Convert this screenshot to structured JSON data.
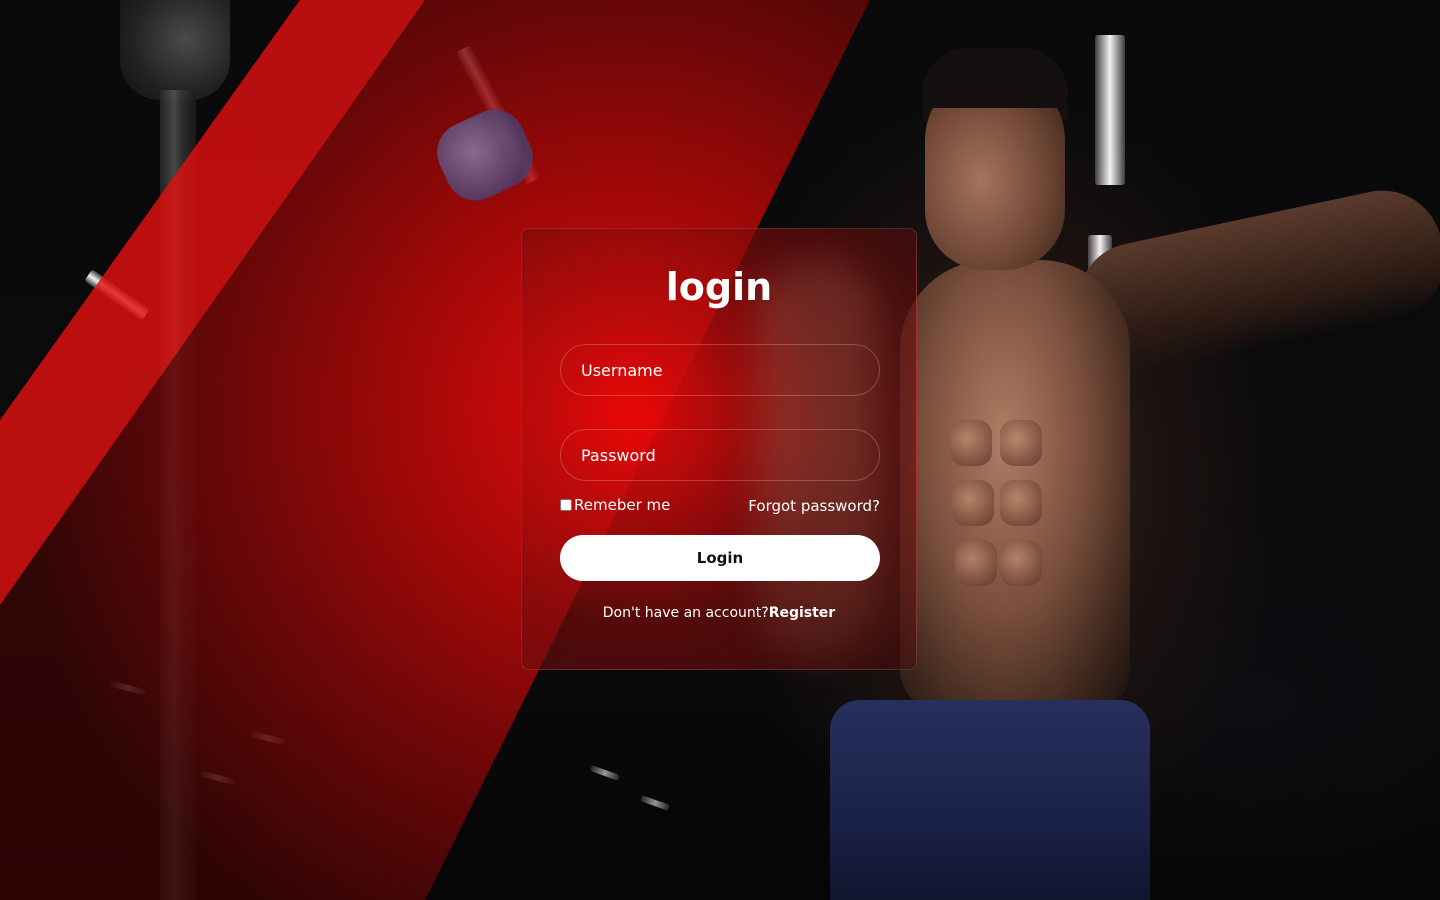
{
  "login_form": {
    "title": "login",
    "username_placeholder": "Username",
    "password_placeholder": "Password",
    "remember_label": "Remeber me",
    "forgot_label": "Forgot password?",
    "submit_label": "Login",
    "register_prompt": "Don't have an account?",
    "register_label": "Register"
  },
  "colors": {
    "accent_red": "#e00808",
    "background": "#050505",
    "button_bg": "#ffffff",
    "text": "#ffffff"
  }
}
